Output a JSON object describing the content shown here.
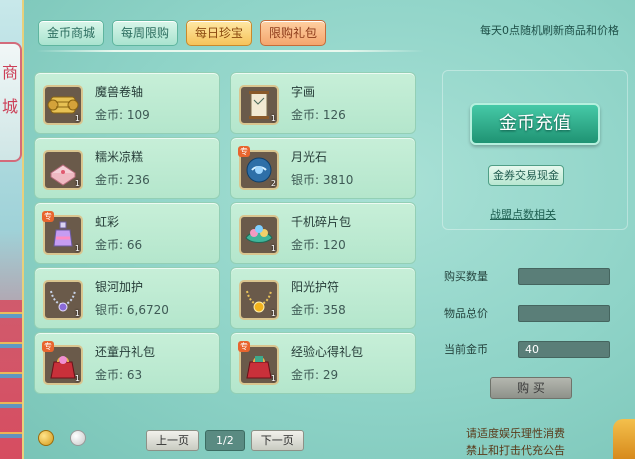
{
  "side": {
    "label_chars": [
      "商",
      "城"
    ]
  },
  "tabs": [
    {
      "label": "金币商城",
      "style": "normal"
    },
    {
      "label": "每周限购",
      "style": "normal"
    },
    {
      "label": "每日珍宝",
      "style": "active"
    },
    {
      "label": "限购礼包",
      "style": "limited"
    }
  ],
  "notice_top": "每天0点随机刷新商品和价格",
  "items": [
    {
      "name": "魔兽卷轴",
      "currency": "金币:",
      "price": "109",
      "qty": "1",
      "special": "",
      "icon": "scroll-gold-icon"
    },
    {
      "name": "字画",
      "currency": "金币:",
      "price": "126",
      "qty": "1",
      "special": "",
      "icon": "painting-scroll-icon"
    },
    {
      "name": "糯米凉糕",
      "currency": "金币:",
      "price": "236",
      "qty": "1",
      "special": "",
      "icon": "rice-cake-icon"
    },
    {
      "name": "月光石",
      "currency": "银币:",
      "price": "3810",
      "qty": "2",
      "special": "专",
      "icon": "moonstone-icon"
    },
    {
      "name": "虹彩",
      "currency": "金币:",
      "price": "66",
      "qty": "1",
      "special": "专",
      "icon": "rainbow-potion-icon"
    },
    {
      "name": "千机碎片包",
      "currency": "金币:",
      "price": "120",
      "qty": "1",
      "special": "",
      "icon": "fragment-bag-icon"
    },
    {
      "name": "银河加护",
      "currency": "银币:",
      "price": "6,6720",
      "qty": "1",
      "special": "",
      "icon": "galaxy-necklace-icon"
    },
    {
      "name": "阳光护符",
      "currency": "金币:",
      "price": "358",
      "qty": "1",
      "special": "",
      "icon": "sun-amulet-icon"
    },
    {
      "name": "还童丹礼包",
      "currency": "金币:",
      "price": "63",
      "qty": "1",
      "special": "专",
      "icon": "gift-bag-red-icon"
    },
    {
      "name": "经验心得礼包",
      "currency": "金币:",
      "price": "29",
      "qty": "1",
      "special": "专",
      "icon": "gift-bag-exp-icon"
    }
  ],
  "pager": {
    "prev": "上一页",
    "page": "1/2",
    "next": "下一页"
  },
  "right": {
    "recharge": "金币充值",
    "coupon": "金券交易现金",
    "alliance": "战盟点数相关"
  },
  "form": {
    "qty_label": "购买数量",
    "qty_value": "",
    "total_label": "物品总价",
    "total_value": "",
    "coin_label": "当前金币",
    "coin_value": "40",
    "buy": "购 买"
  },
  "notice_bottom": [
    "请适度娱乐理性消费",
    "禁止和打击代充公告"
  ],
  "colors": {
    "accent_gold": "#f6c35a",
    "panel_teal": "#8ed3c7",
    "recharge_green": "#1f9373"
  }
}
